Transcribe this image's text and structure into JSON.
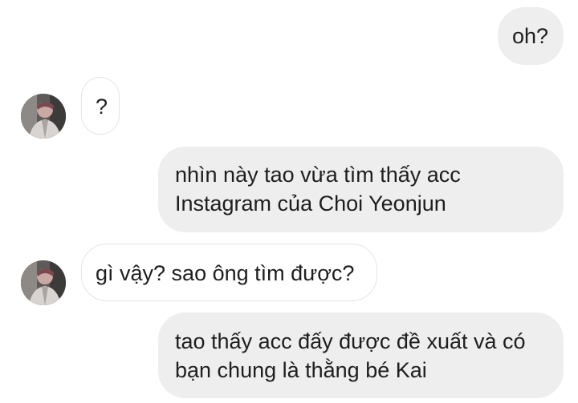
{
  "messages": [
    {
      "direction": "outgoing",
      "lines": [
        "oh?"
      ]
    },
    {
      "direction": "incoming",
      "lines": [
        "?"
      ]
    },
    {
      "direction": "outgoing",
      "lines": [
        "nhìn này tao vừa tìm thấy acc",
        "Instagram của Choi Yeonjun"
      ]
    },
    {
      "direction": "incoming",
      "lines": [
        "gì vậy? sao ông tìm được?"
      ]
    },
    {
      "direction": "outgoing",
      "lines": [
        "tao thấy acc đấy được đề xuất và có",
        "bạn chung là thằng bé Kai"
      ]
    }
  ],
  "colors": {
    "outgoing_bubble": "#eeeeef",
    "incoming_border": "#e4e4e6",
    "text": "#1e1e1e",
    "background": "#ffffff"
  }
}
